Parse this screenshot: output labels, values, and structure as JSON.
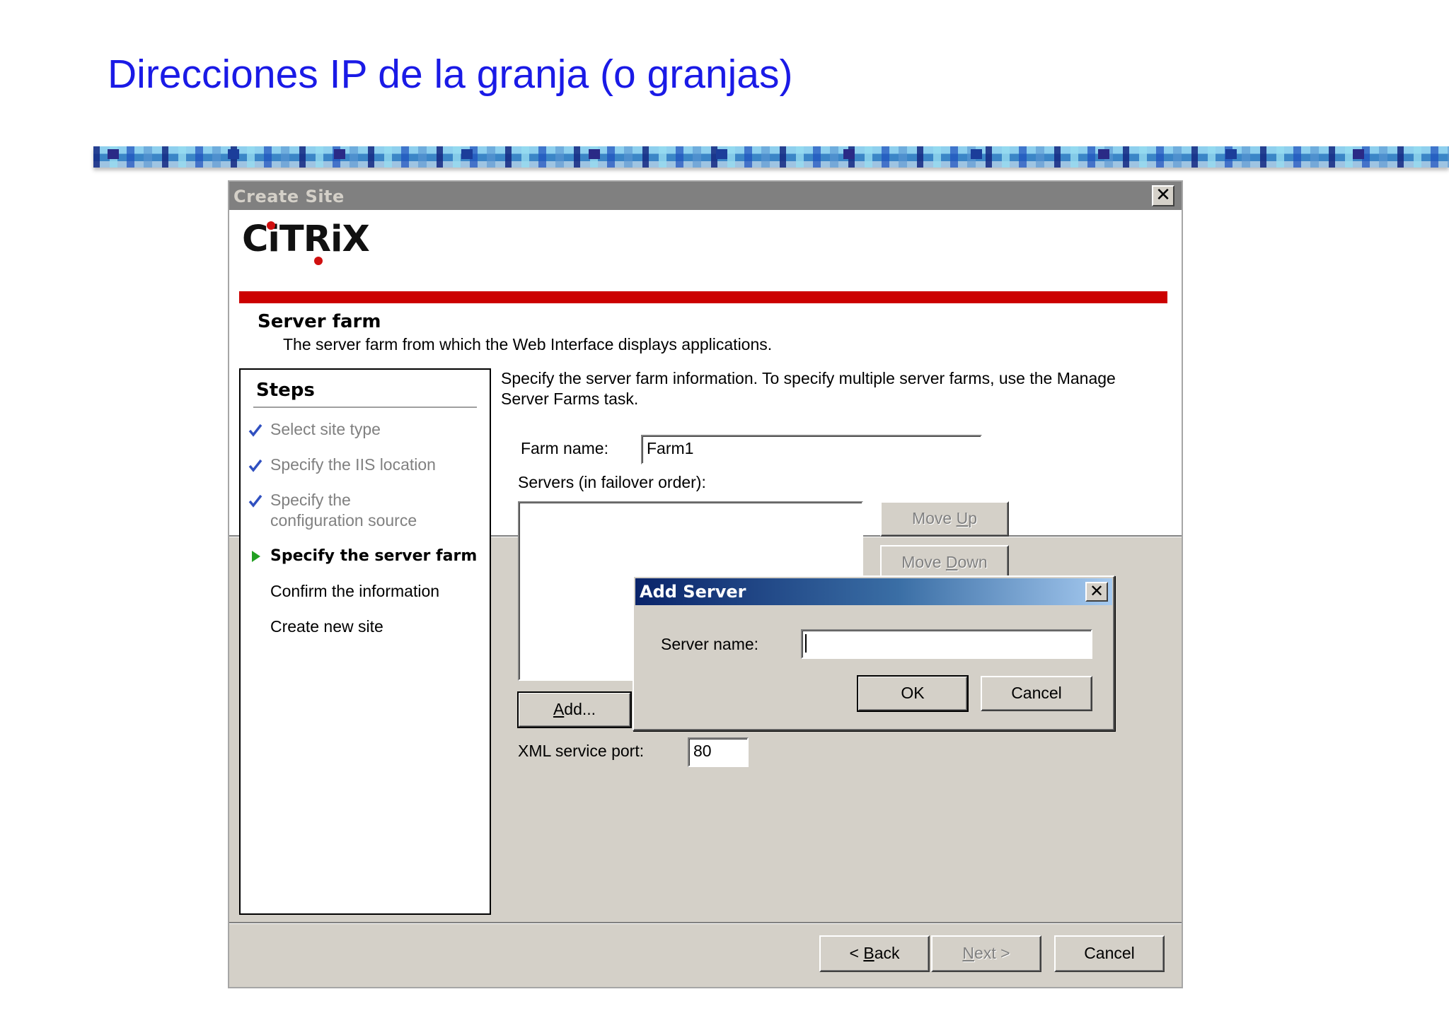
{
  "slide": {
    "title": "Direcciones IP de la granja (o granjas)"
  },
  "window": {
    "title": "Create Site",
    "close_glyph": "✕",
    "logo": "CiTRiX",
    "section_title": "Server farm",
    "section_desc": "The server farm from which the Web Interface displays applications."
  },
  "steps": {
    "heading": "Steps",
    "items": [
      {
        "label": "Select site type",
        "state": "done"
      },
      {
        "label": "Specify the IIS location",
        "state": "done"
      },
      {
        "label_line1": "Specify the",
        "label_line2": "configuration source",
        "state": "done"
      },
      {
        "label": "Specify the server farm",
        "state": "current"
      },
      {
        "label": "Confirm the information",
        "state": "todo"
      },
      {
        "label": "Create new site",
        "state": "todo"
      }
    ]
  },
  "form": {
    "intro_line1": "Specify the server farm information.  To specify multiple server farms, use the Manage",
    "intro_line2": "Server Farms task.",
    "farm_name_label": "Farm name:",
    "farm_name_value": "Farm1",
    "servers_label": "Servers (in failover order):",
    "move_up_label_pre": "Move ",
    "move_up_label_key": "U",
    "move_up_label_post": "p",
    "move_down_label_pre": "Move ",
    "move_down_label_key": "D",
    "move_down_label_post": "own",
    "add_label_key": "A",
    "add_label_post": "dd...",
    "xml_port_label": "XML service port:",
    "xml_port_value": "80"
  },
  "footer": {
    "back_pre": "< ",
    "back_key": "B",
    "back_post": "ack",
    "next_key": "N",
    "next_post": "ext >",
    "cancel_label": "Cancel"
  },
  "add_server_dialog": {
    "title": "Add Server",
    "close_glyph": "✕",
    "server_name_label": "Server name:",
    "server_name_value": "",
    "ok_label": "OK",
    "cancel_label": "Cancel"
  },
  "colors": {
    "title_blue": "#1a1ae6",
    "citrix_red": "#cc0000",
    "step_arrow_green": "#22a022",
    "check_blue": "#3050c0",
    "dialog_titlebar": "#0a246a"
  }
}
